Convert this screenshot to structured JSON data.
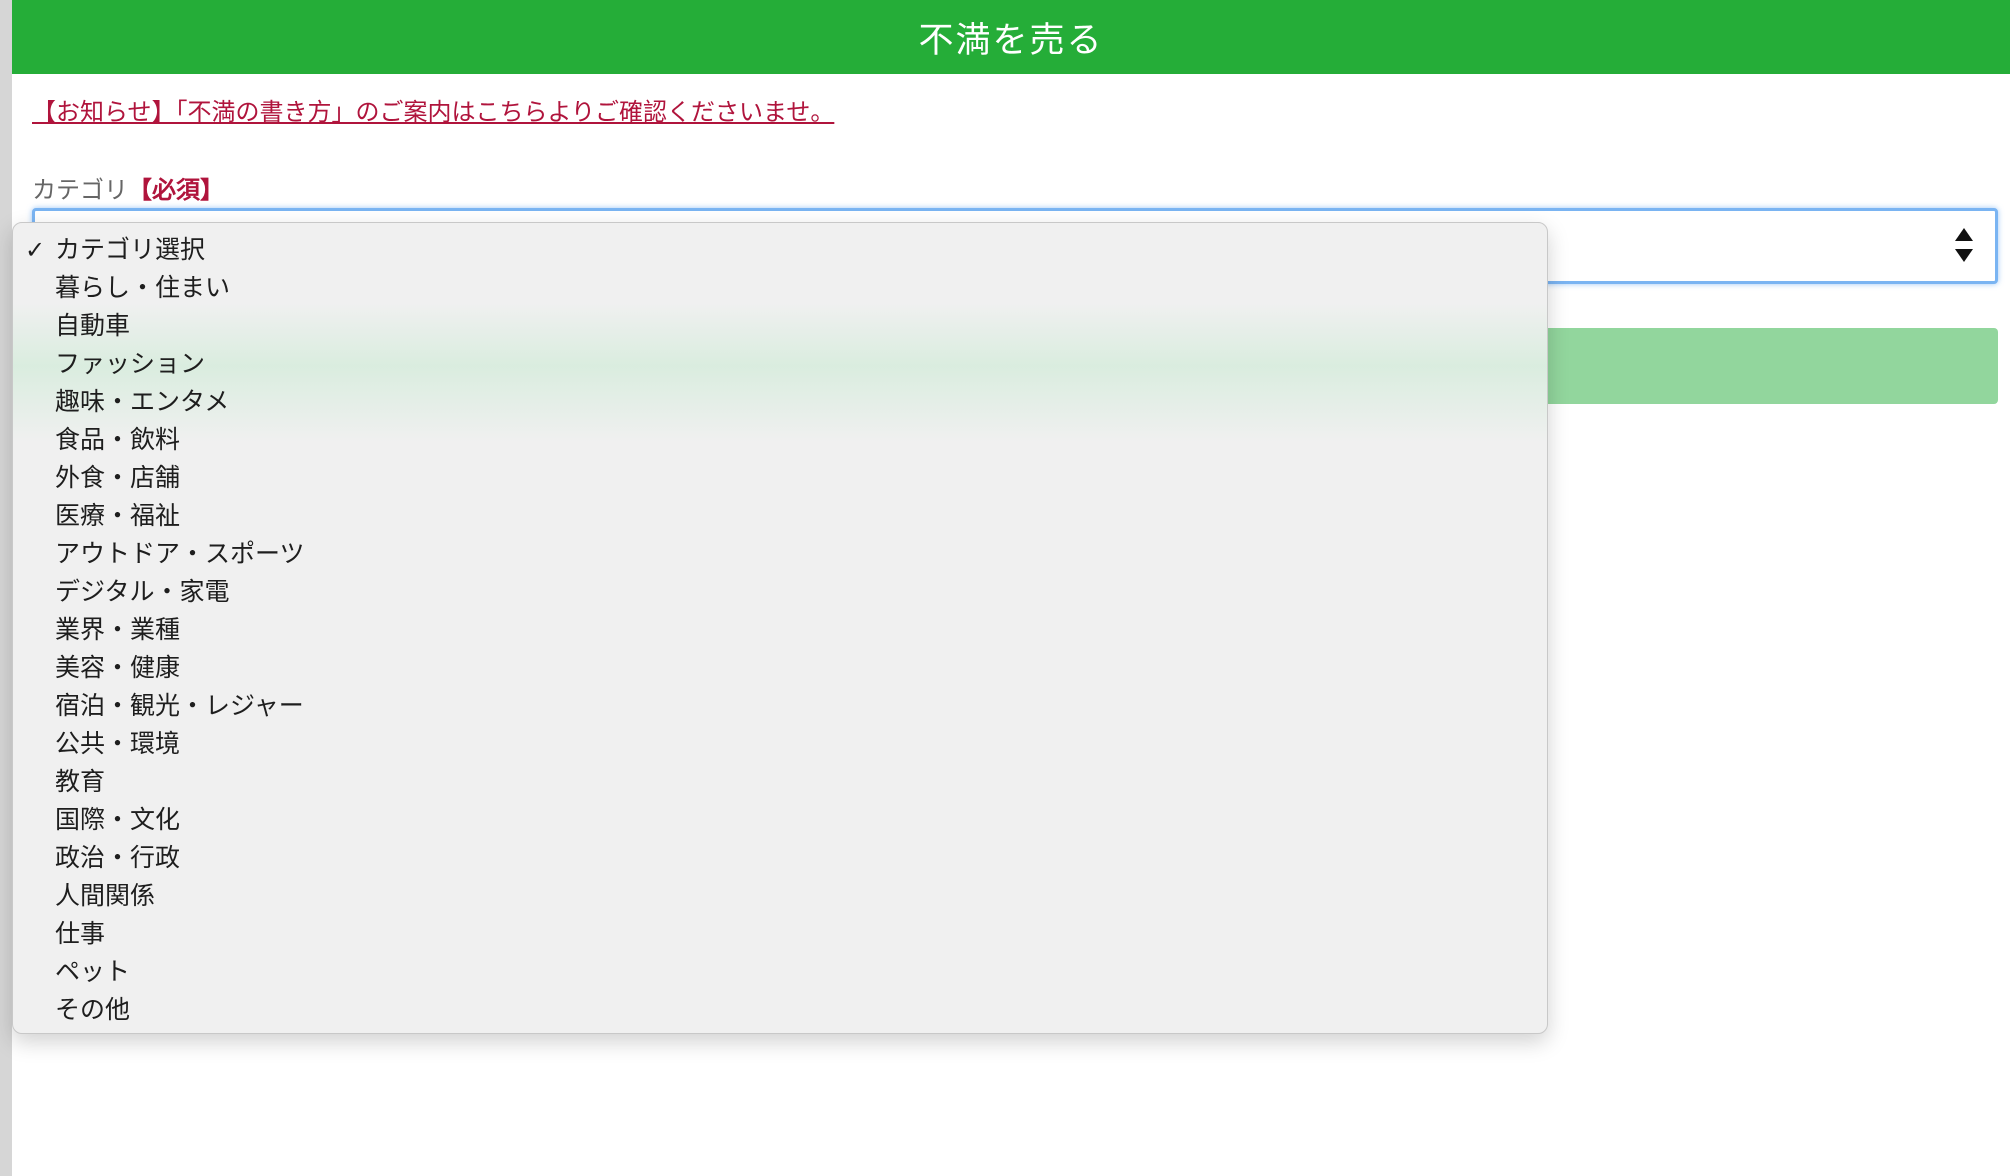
{
  "header": {
    "title": "不満を売る",
    "color": "#25ad38"
  },
  "notice": {
    "link_text": "【お知らせ】「不満の書き方」のご案内はこちらよりご確認くださいませ。",
    "color": "#b0143c"
  },
  "category": {
    "label": "カテゴリ",
    "required": "【必須】",
    "selected": "カテゴリ選択",
    "options": [
      "カテゴリ選択",
      "暮らし・住まい",
      "自動車",
      "ファッション",
      "趣味・エンタメ",
      "食品・飲料",
      "外食・店舗",
      "医療・福祉",
      "アウトドア・スポーツ",
      "デジタル・家電",
      "業界・業種",
      "美容・健康",
      "宿泊・観光・レジャー",
      "公共・環境",
      "教育",
      "国際・文化",
      "政治・行政",
      "人間関係",
      "仕事",
      "ペット",
      "その他"
    ]
  },
  "icons": {
    "selected_marker": "checkmark-icon",
    "select_arrows": "up-down-arrows-icon"
  },
  "submit": {
    "color": "#92d69d"
  }
}
